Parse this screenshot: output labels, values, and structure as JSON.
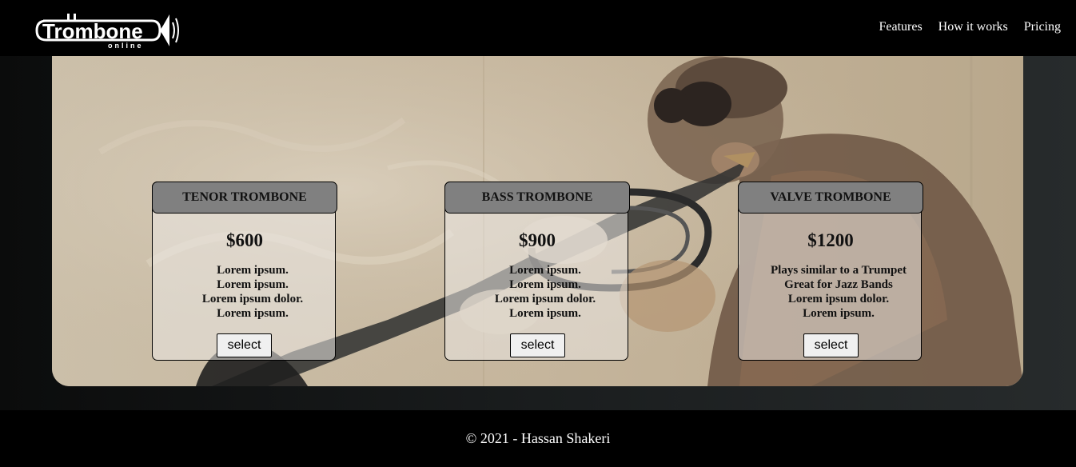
{
  "brand": {
    "logo_text": "Trombone",
    "logo_subtext": "online"
  },
  "nav": {
    "items": [
      {
        "label": "Features"
      },
      {
        "label": "How it works"
      },
      {
        "label": "Pricing"
      }
    ]
  },
  "pricing": {
    "cards": [
      {
        "title": "TENOR TROMBONE",
        "price": "$600",
        "features": [
          "Lorem ipsum.",
          "Lorem ipsum.",
          "Lorem ipsum dolor.",
          "Lorem ipsum."
        ],
        "button_label": "select"
      },
      {
        "title": "BASS TROMBONE",
        "price": "$900",
        "features": [
          "Lorem ipsum.",
          "Lorem ipsum.",
          "Lorem ipsum dolor.",
          "Lorem ipsum."
        ],
        "button_label": "select"
      },
      {
        "title": "VALVE TROMBONE",
        "price": "$1200",
        "features": [
          "Plays similar to a Trumpet",
          "Great for Jazz Bands",
          "Lorem ipsum dolor.",
          "Lorem ipsum."
        ],
        "button_label": "select"
      }
    ]
  },
  "footer": {
    "copyright": "© 2021 - Hassan Shakeri"
  },
  "colors": {
    "header_bg": "#000000",
    "card_header_bg": "#808080",
    "hero_bg": "#c9bba4"
  }
}
